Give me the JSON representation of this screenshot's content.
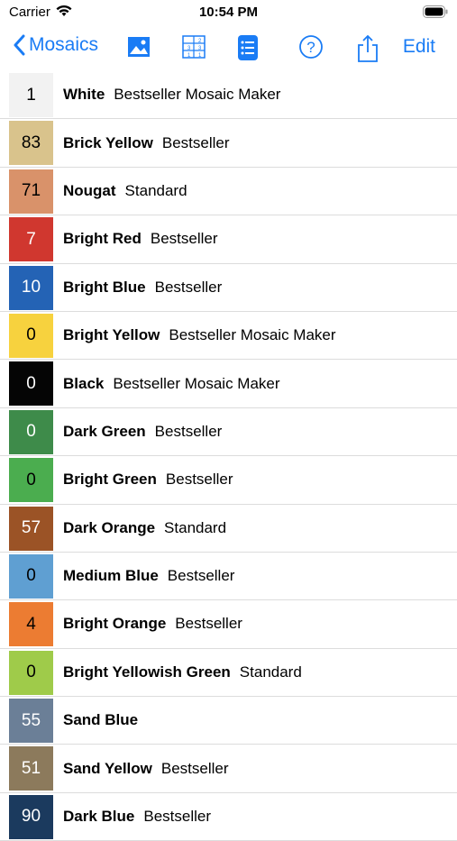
{
  "status": {
    "carrier": "Carrier",
    "time": "10:54 PM"
  },
  "nav": {
    "back_label": "Mosaics",
    "edit_label": "Edit"
  },
  "colors": {
    "accent": "#1a7cf5"
  },
  "rows": [
    {
      "count": "1",
      "name": "White",
      "tags": "Bestseller Mosaic Maker",
      "color": "#f2f2f2",
      "text": "#000000"
    },
    {
      "count": "83",
      "name": "Brick Yellow",
      "tags": "Bestseller",
      "color": "#d9c38c",
      "text": "#000000"
    },
    {
      "count": "71",
      "name": "Nougat",
      "tags": "Standard",
      "color": "#d9926a",
      "text": "#000000"
    },
    {
      "count": "7",
      "name": "Bright Red",
      "tags": "Bestseller",
      "color": "#d0372f",
      "text": "#ffffff"
    },
    {
      "count": "10",
      "name": "Bright Blue",
      "tags": "Bestseller",
      "color": "#2463b5",
      "text": "#ffffff"
    },
    {
      "count": "0",
      "name": "Bright Yellow",
      "tags": "Bestseller Mosaic Maker",
      "color": "#f7d23e",
      "text": "#000000"
    },
    {
      "count": "0",
      "name": "Black",
      "tags": "Bestseller Mosaic Maker",
      "color": "#050505",
      "text": "#ffffff"
    },
    {
      "count": "0",
      "name": "Dark Green",
      "tags": "Bestseller",
      "color": "#3e8b4a",
      "text": "#ffffff"
    },
    {
      "count": "0",
      "name": "Bright Green",
      "tags": "Bestseller",
      "color": "#4bad4f",
      "text": "#000000"
    },
    {
      "count": "57",
      "name": "Dark Orange",
      "tags": "Standard",
      "color": "#9b5326",
      "text": "#ffffff"
    },
    {
      "count": "0",
      "name": "Medium Blue",
      "tags": "Bestseller",
      "color": "#5f9fd2",
      "text": "#000000"
    },
    {
      "count": "4",
      "name": "Bright Orange",
      "tags": "Bestseller",
      "color": "#ec7c32",
      "text": "#000000"
    },
    {
      "count": "0",
      "name": "Bright Yellowish Green",
      "tags": "Standard",
      "color": "#9fcb4a",
      "text": "#000000"
    },
    {
      "count": "55",
      "name": "Sand Blue",
      "tags": "",
      "color": "#6b7f97",
      "text": "#ffffff"
    },
    {
      "count": "51",
      "name": "Sand Yellow",
      "tags": "Bestseller",
      "color": "#8c7a5c",
      "text": "#ffffff"
    },
    {
      "count": "90",
      "name": "Dark Blue",
      "tags": "Bestseller",
      "color": "#1b3a5e",
      "text": "#ffffff"
    }
  ]
}
